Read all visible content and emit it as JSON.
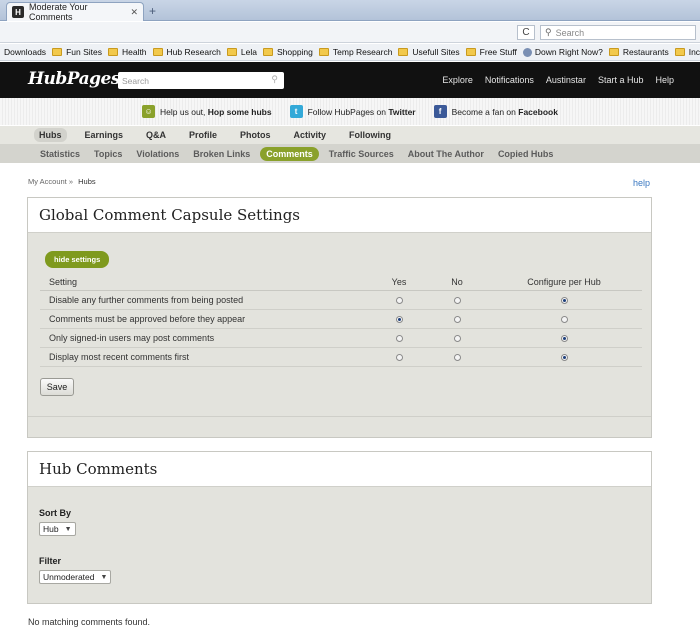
{
  "browser": {
    "tab_title": "Moderate Your Comments",
    "favicon": "H",
    "close": "✕",
    "newtab": "+",
    "reload": "C",
    "search_placeholder": "Search"
  },
  "bookmarks": [
    {
      "label": "Downloads",
      "icon": "none"
    },
    {
      "label": "Fun Sites",
      "icon": "folder"
    },
    {
      "label": "Health",
      "icon": "folder"
    },
    {
      "label": "Hub Research",
      "icon": "folder"
    },
    {
      "label": "Lela",
      "icon": "folder"
    },
    {
      "label": "Shopping",
      "icon": "folder"
    },
    {
      "label": "Temp Research",
      "icon": "folder"
    },
    {
      "label": "Usefull Sites",
      "icon": "folder"
    },
    {
      "label": "Free Stuff",
      "icon": "folder"
    },
    {
      "label": "Down Right Now?",
      "icon": "globe"
    },
    {
      "label": "Restaurants",
      "icon": "folder"
    },
    {
      "label": "Income sites",
      "icon": "folder"
    }
  ],
  "site": {
    "logo": "HubPages",
    "search_placeholder": "Search",
    "topnav": [
      "Explore",
      "Notifications",
      "Austinstar",
      "Start a Hub",
      "Help"
    ]
  },
  "promo": {
    "hop_text": "Help us out,",
    "hop_bold": "Hop some hubs",
    "twitter_text": "Follow HubPages on",
    "twitter_bold": "Twitter",
    "facebook_text": "Become a fan on",
    "facebook_bold": "Facebook"
  },
  "main_tabs": [
    "Hubs",
    "Earnings",
    "Q&A",
    "Profile",
    "Photos",
    "Activity",
    "Following"
  ],
  "main_tab_active": "Hubs",
  "sub_tabs": [
    "Statistics",
    "Topics",
    "Violations",
    "Broken Links",
    "Comments",
    "Traffic Sources",
    "About The Author",
    "Copied Hubs"
  ],
  "sub_tab_active": "Comments",
  "breadcrumb": {
    "parent": "My Account »",
    "current": "Hubs"
  },
  "help_link": "help",
  "global_settings": {
    "title": "Global Comment Capsule Settings",
    "hide_button": "hide settings",
    "columns": [
      "Setting",
      "Yes",
      "No",
      "Configure per Hub"
    ],
    "rows": [
      {
        "label": "Disable any further comments from being posted",
        "selected": 2
      },
      {
        "label": "Comments must be approved before they appear",
        "selected": 0
      },
      {
        "label": "Only signed-in users may post comments",
        "selected": 2
      },
      {
        "label": "Display most recent comments first",
        "selected": 2
      }
    ],
    "save_button": "Save"
  },
  "hub_comments": {
    "title": "Hub Comments",
    "sort_label": "Sort By",
    "sort_value": "Hub",
    "filter_label": "Filter",
    "filter_value": "Unmoderated"
  },
  "empty_message": "No matching comments found."
}
